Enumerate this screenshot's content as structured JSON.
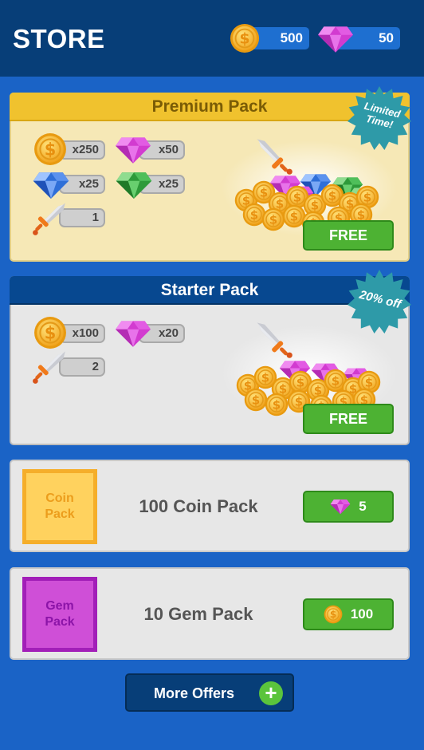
{
  "header": {
    "title": "STORE",
    "coins": "500",
    "gems": "50"
  },
  "premium_pack": {
    "title": "Premium Pack",
    "badge_line1": "Limited",
    "badge_line2": "Time!",
    "items": {
      "coins": "x250",
      "pink_gems": "x50",
      "blue_gems": "x25",
      "green_gems": "x25",
      "swords": "1"
    },
    "button": "FREE"
  },
  "starter_pack": {
    "title": "Starter Pack",
    "badge": "20% off",
    "items": {
      "coins": "x100",
      "pink_gems": "x20",
      "swords": "2"
    },
    "button": "FREE"
  },
  "offers": [
    {
      "box_line1": "Coin",
      "box_line2": "Pack",
      "title": "100 Coin Pack",
      "price_icon": "gem-icon",
      "price": "5"
    },
    {
      "box_line1": "Gem",
      "box_line2": "Pack",
      "title": "10 Gem Pack",
      "price_icon": "coin-icon",
      "price": "100"
    }
  ],
  "more_offers": "More Offers",
  "colors": {
    "background": "#1a63c6",
    "header": "#073e78",
    "green_button": "#4db233",
    "premium_banner": "#f0c22e",
    "starter_banner": "#074890",
    "badge": "#2e9aa8"
  }
}
